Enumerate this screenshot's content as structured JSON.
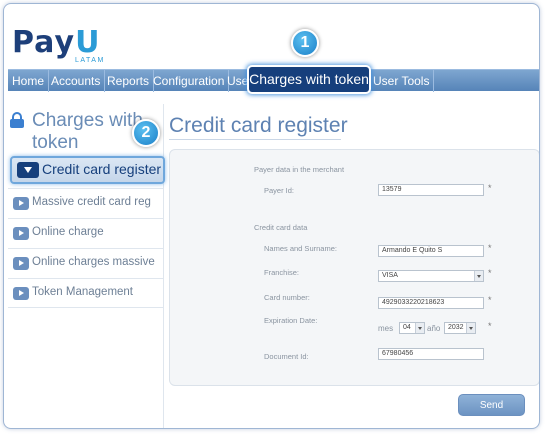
{
  "brand": {
    "logo_part1": "Pay",
    "logo_part2": "U",
    "logo_sub": "LATAM",
    "colors": {
      "dark_blue": "#163f7c",
      "accent_blue": "#2b9bd6",
      "nav_blue": "#6c93c2"
    }
  },
  "nav": {
    "items": [
      "Home",
      "Accounts",
      "Reports",
      "Configuration",
      "Use",
      "User Tools"
    ],
    "highlighted": "Charges with token"
  },
  "badges": {
    "first": "1",
    "second": "2"
  },
  "sidebar": {
    "title": "Charges with token",
    "active_item": "Credit card register",
    "items": [
      "Massive credit card reg",
      "Online charge",
      "Online charges massive",
      "Token Management"
    ]
  },
  "main": {
    "title": "Credit card register",
    "payer_section": "Payer data in the merchant",
    "payer_id_label": "Payer Id:",
    "payer_id_value": "13579",
    "card_section": "Credit card data",
    "name_label": "Names and Surname:",
    "name_value": "Armando E Quito S",
    "franchise_label": "Franchise:",
    "franchise_value": "VISA",
    "card_number_label": "Card number:",
    "card_number_value": "4929033220218623",
    "expiration_label": "Expiration Date:",
    "month_prefix": "mes",
    "month_value": "04",
    "year_prefix": "año",
    "year_value": "2032",
    "document_label": "Document Id:",
    "document_value": "67980456",
    "required_mark": "*",
    "send_label": "Send"
  }
}
